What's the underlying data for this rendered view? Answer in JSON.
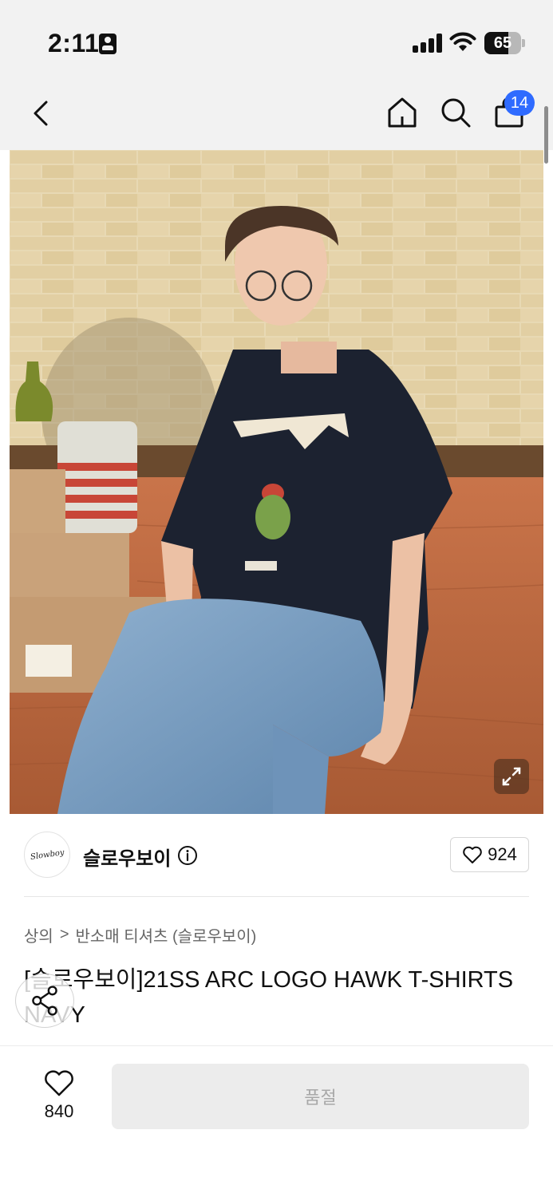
{
  "status_bar": {
    "time": "2:11",
    "battery": "65",
    "battery_level": 0.65
  },
  "nav": {
    "icons": [
      "back-arrow-icon",
      "home-icon",
      "search-icon",
      "shopping-bag-icon"
    ],
    "cart_badge": "14",
    "accent_color": "#2f6bff"
  },
  "hero": {
    "icon": "expand-icon"
  },
  "brand": {
    "name": "슬로우보이",
    "logo_text": "Slowboy",
    "like_count": "924"
  },
  "breadcrumb": {
    "category": "상의",
    "subcategory": "반소매 티셔츠 (슬로우보이)",
    "separator": ">"
  },
  "product": {
    "title": "[슬로우보이]21SS ARC LOGO HAWK T-SHIRTS NAVY"
  },
  "bottom_bar": {
    "wish_count": "840",
    "cta_label": "품절"
  }
}
